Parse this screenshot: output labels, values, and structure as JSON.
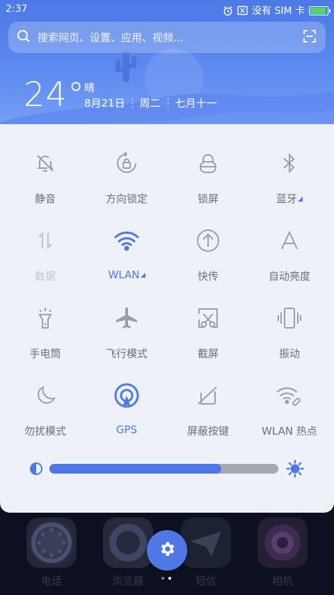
{
  "status": {
    "time": "2:37",
    "sim": "没有 SIM 卡",
    "battery_level": 0.9,
    "battery_color": "#4cd964"
  },
  "search": {
    "placeholder": "搜索网页、设置、应用、视频..."
  },
  "weather": {
    "temperature": "24°",
    "condition": "晴",
    "date": "8月21日",
    "weekday": "周二",
    "lunar": "七月十一"
  },
  "toggles": [
    {
      "label": "静音",
      "icon": "bell-off-icon",
      "state": "normal"
    },
    {
      "label": "方向锁定",
      "icon": "rotation-lock-icon",
      "state": "normal"
    },
    {
      "label": "锁屏",
      "icon": "lock-icon",
      "state": "normal"
    },
    {
      "label": "蓝牙",
      "icon": "bluetooth-icon",
      "state": "normal",
      "has_menu": true
    },
    {
      "label": "数据",
      "icon": "mobile-data-icon",
      "state": "disabled"
    },
    {
      "label": "WLAN",
      "icon": "wifi-icon",
      "state": "on",
      "has_menu": true
    },
    {
      "label": "快传",
      "icon": "quick-transfer-icon",
      "state": "normal"
    },
    {
      "label": "自动亮度",
      "icon": "auto-brightness-icon",
      "state": "normal"
    },
    {
      "label": "手电筒",
      "icon": "flashlight-icon",
      "state": "normal"
    },
    {
      "label": "飞行模式",
      "icon": "airplane-icon",
      "state": "normal"
    },
    {
      "label": "截屏",
      "icon": "screenshot-icon",
      "state": "normal"
    },
    {
      "label": "振动",
      "icon": "vibrate-icon",
      "state": "normal"
    },
    {
      "label": "勿扰模式",
      "icon": "moon-icon",
      "state": "normal"
    },
    {
      "label": "GPS",
      "icon": "gps-icon",
      "state": "on"
    },
    {
      "label": "屏蔽按键",
      "icon": "button-block-icon",
      "state": "normal"
    },
    {
      "label": "WLAN 热点",
      "icon": "hotspot-icon",
      "state": "normal"
    }
  ],
  "brightness": {
    "level": 0.75,
    "accent": "#4f77e6"
  },
  "dock": [
    {
      "label": "电话",
      "icon": "phone-app-icon"
    },
    {
      "label": "浏览器",
      "icon": "browser-app-icon"
    },
    {
      "label": "短信",
      "icon": "messages-app-icon"
    },
    {
      "label": "相机",
      "icon": "camera-app-icon"
    }
  ],
  "pager": {
    "pages": 2,
    "current": 1
  }
}
